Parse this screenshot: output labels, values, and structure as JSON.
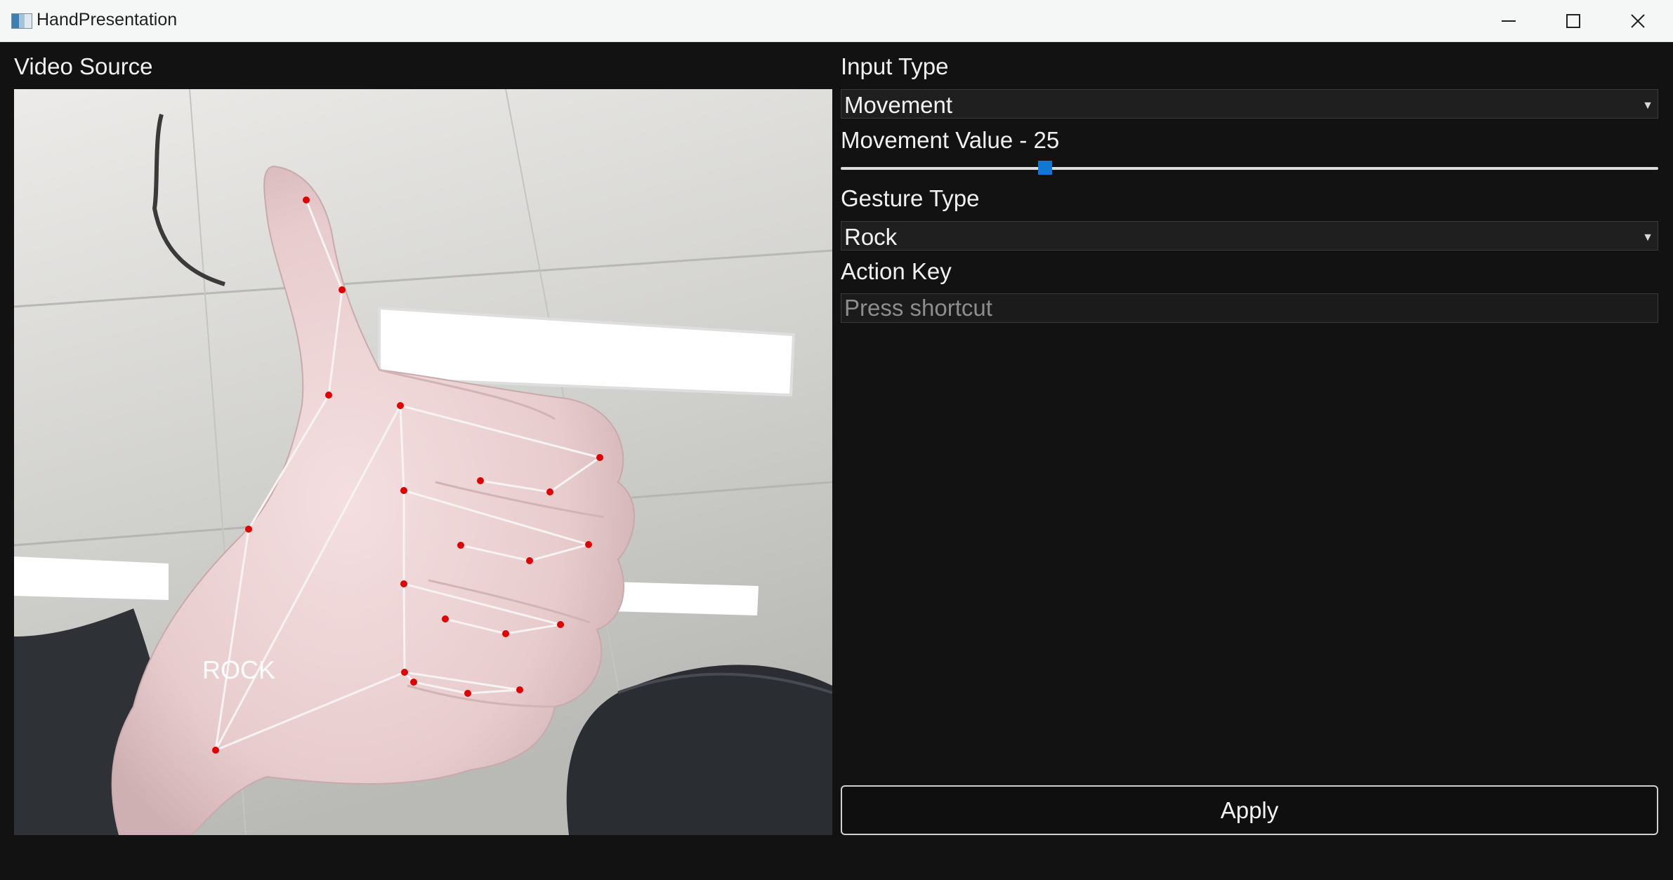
{
  "window": {
    "title": "HandPresentation",
    "icon": "app-icon",
    "controls": [
      "minimize-icon",
      "maximize-icon",
      "close-icon"
    ]
  },
  "video_panel": {
    "label": "Video Source",
    "overlay_text": "ROCK"
  },
  "settings": {
    "input_type_label": "Input Type",
    "input_type_value": "Movement",
    "movement_label": "Movement Value - 25",
    "movement_value": 25,
    "gesture_type_label": "Gesture Type",
    "gesture_type_value": "Rock",
    "action_key_label": "Action Key",
    "action_key_placeholder": "Press shortcut",
    "apply_label": "Apply"
  },
  "colors": {
    "accent": "#1177d6",
    "background": "#121212",
    "landmark": "#e00000"
  }
}
